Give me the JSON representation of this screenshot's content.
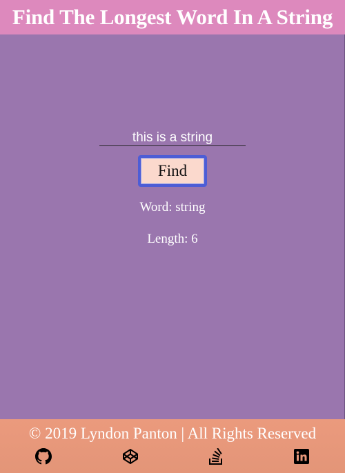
{
  "header": {
    "title": "Find The Longest Word In A String"
  },
  "form": {
    "input_value": "this is a string",
    "button_label": "Find"
  },
  "results": {
    "word_text": "Word: string",
    "length_text": "Length: 6"
  },
  "footer": {
    "copyright": "© 2019 Lyndon Panton | All Rights Reserved",
    "social_icons": [
      "github-icon",
      "codepen-icon",
      "stackoverflow-icon",
      "linkedin-icon"
    ]
  },
  "colors": {
    "background": "#9a76ae",
    "header": "#dd89bd",
    "footer": "#e8997b",
    "button": "#fbd9cd",
    "button_border": "#4d5dd6"
  }
}
